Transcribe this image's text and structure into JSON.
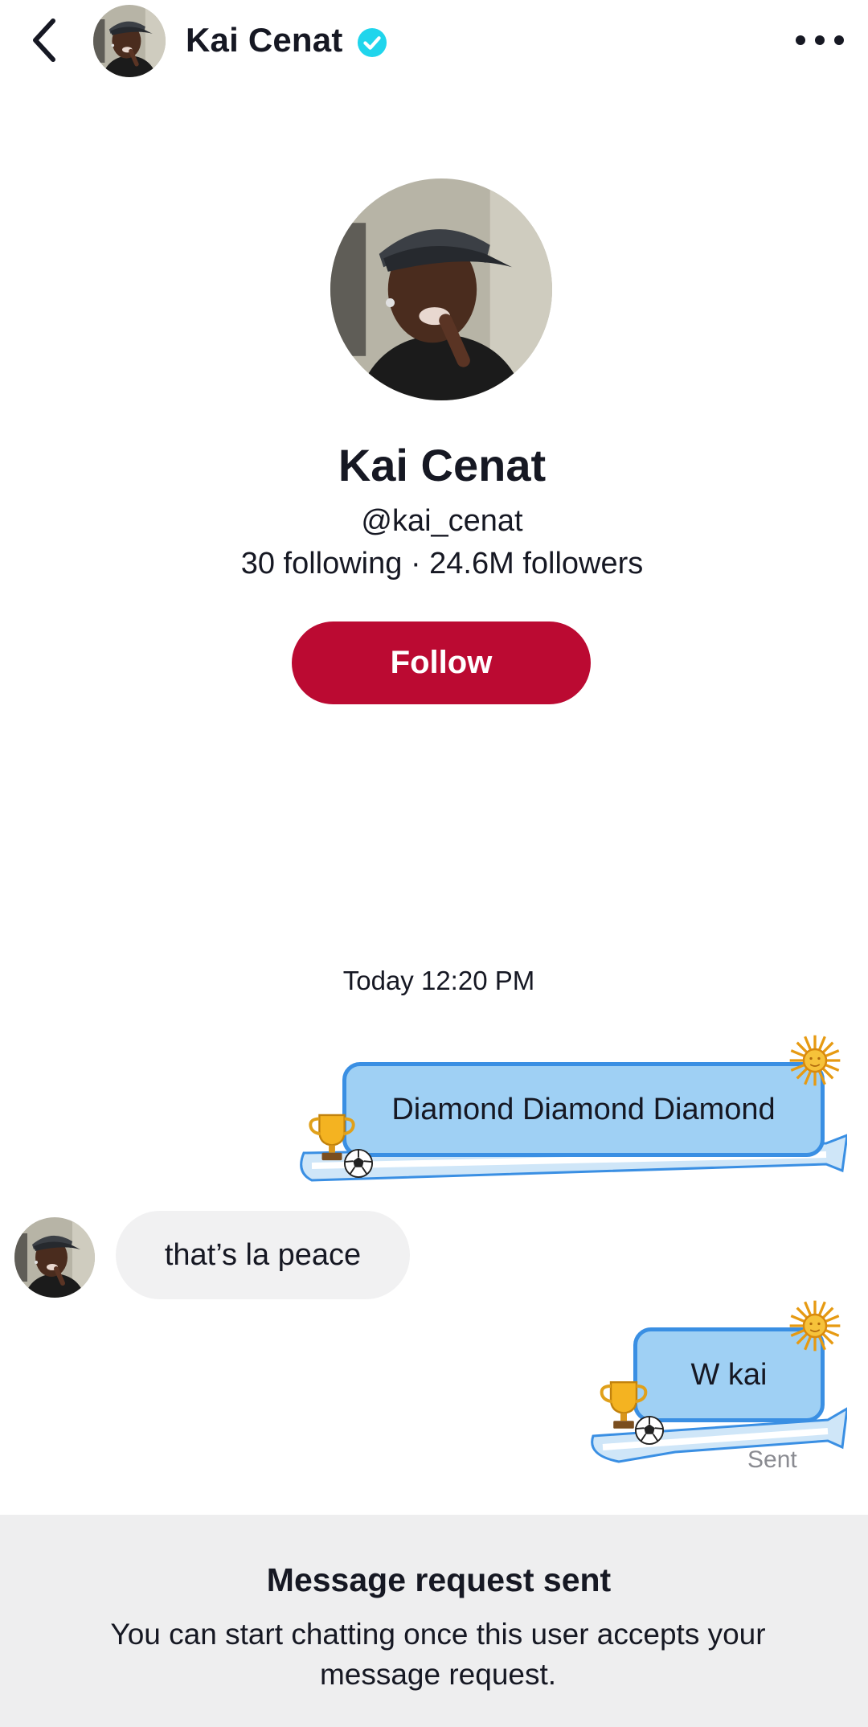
{
  "header": {
    "title": "Kai Cenat",
    "back_icon": "chevron-left-icon",
    "verified_icon": "verified-badge-icon",
    "more_icon": "more-horizontal-icon"
  },
  "profile": {
    "name": "Kai Cenat",
    "handle": "@kai_cenat",
    "stats": "30 following · 24.6M followers",
    "follow_label": "Follow"
  },
  "chat": {
    "timestamp": "Today 12:20 PM",
    "messages": [
      {
        "direction": "outgoing",
        "text": "Diamond Diamond Diamond"
      },
      {
        "direction": "incoming",
        "text": "that’s la peace"
      },
      {
        "direction": "outgoing",
        "text": "W kai",
        "status": "Sent"
      }
    ]
  },
  "banner": {
    "title": "Message request sent",
    "body": "You can start chatting once this user accepts your message request."
  },
  "colors": {
    "follow_button": "#bb0a32",
    "bubble_fill": "#9fd0f4",
    "bubble_border": "#3a8fe3",
    "verified": "#20d5ec"
  }
}
